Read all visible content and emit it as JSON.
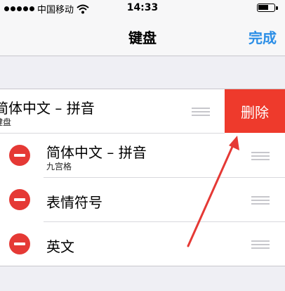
{
  "status_bar": {
    "carrier": "中国移动",
    "time": "14:33",
    "signal_icon": "signal-dots-icon",
    "wifi_icon": "wifi-icon",
    "battery_icon": "battery-icon"
  },
  "nav": {
    "title": "键盘",
    "done_label": "完成"
  },
  "keyboards": [
    {
      "title": "简体中文 – 拼音",
      "subtitle": "键盘",
      "action": "删除",
      "swiped": true
    },
    {
      "title": "简体中文 – 拼音",
      "subtitle": "九宫格"
    },
    {
      "title": "表情符号"
    },
    {
      "title": "英文"
    }
  ],
  "colors": {
    "accent": "#2b8ee6",
    "delete": "#ee3a2c",
    "arrow": "#e53935"
  }
}
